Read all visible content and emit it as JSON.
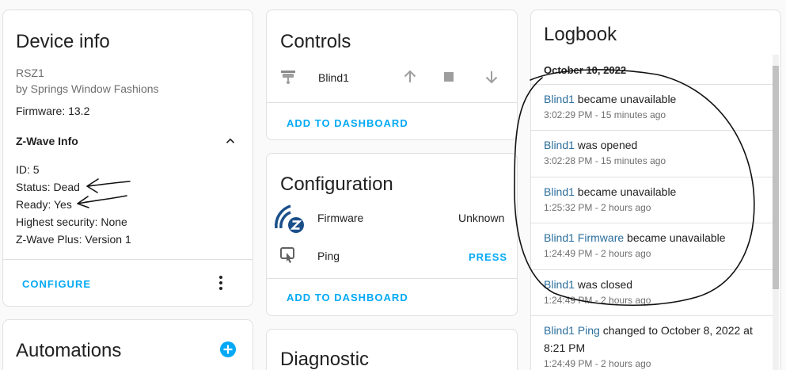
{
  "device_info": {
    "title": "Device info",
    "model": "RSZ1",
    "manufacturer": "by Springs Window Fashions",
    "firmware": "Firmware: 13.2",
    "zwave_header": "Z-Wave Info",
    "id": "ID: 5",
    "status": "Status: Dead",
    "ready": "Ready: Yes",
    "security": "Highest security: None",
    "plus": "Z-Wave Plus: Version 1",
    "configure_label": "CONFIGURE"
  },
  "automations": {
    "title": "Automations"
  },
  "controls": {
    "title": "Controls",
    "entity_name": "Blind1",
    "add_label": "ADD TO DASHBOARD"
  },
  "configuration": {
    "title": "Configuration",
    "firmware_label": "Firmware",
    "firmware_value": "Unknown",
    "ping_label": "Ping",
    "press_label": "PRESS",
    "add_label": "ADD TO DASHBOARD"
  },
  "diagnostic": {
    "title": "Diagnostic"
  },
  "logbook": {
    "title": "Logbook",
    "date": "October 10, 2022",
    "entries": [
      {
        "entity": "Blind1",
        "text": " became unavailable",
        "time": "3:02:29 PM - 15 minutes ago"
      },
      {
        "entity": "Blind1",
        "text": " was opened",
        "time": "3:02:28 PM - 15 minutes ago"
      },
      {
        "entity": "Blind1",
        "text": " became unavailable",
        "time": "1:25:32 PM - 2 hours ago"
      },
      {
        "entity": "Blind1 Firmware",
        "text": " became unavailable",
        "time": "1:24:49 PM - 2 hours ago"
      },
      {
        "entity": "Blind1",
        "text": " was closed",
        "time": "1:24:49 PM - 2 hours ago"
      },
      {
        "entity": "Blind1 Ping",
        "text": " changed to October 8, 2022 at",
        "text2": "8:21 PM",
        "time": "1:24:49 PM - 2 hours ago"
      }
    ]
  },
  "colors": {
    "accent": "#03a9f4",
    "link": "#2b6e9c",
    "icon_gray": "#9e9e9e",
    "zwave_blue": "#1b4f8a"
  }
}
